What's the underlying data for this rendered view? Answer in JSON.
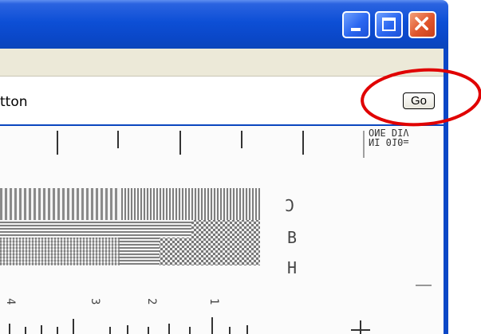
{
  "window": {
    "controls": [
      "minimize-icon",
      "maximize-icon",
      "close-icon"
    ]
  },
  "toolbar": {
    "address_text": "tton",
    "go_label": "Go"
  },
  "annotation": {
    "color": "#e00000"
  },
  "test_chart": {
    "corner_label_line1": "NI 010=",
    "corner_label_line2": "ONE DIV",
    "letters": [
      "C",
      "B",
      "H"
    ],
    "scale_numbers": [
      "4",
      "3",
      "2",
      "1"
    ]
  }
}
